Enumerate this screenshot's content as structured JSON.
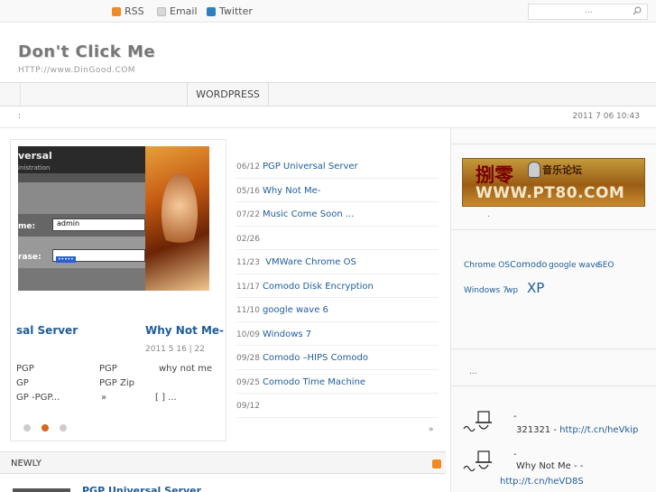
{
  "topbar": {
    "rss_label": "RSS",
    "email_label": "Email",
    "twitter_label": "Twitter",
    "search_placeholder": "...",
    "rss_icon": "rss-icon",
    "email_icon": "mail-icon",
    "twitter_icon": "twitter-icon"
  },
  "header": {
    "site_title": "Don't Click Me",
    "site_url": "HTTP://www.DinGood.COM"
  },
  "nav": {
    "items": [
      "WORDPRESS"
    ]
  },
  "infobar": {
    "left_text": ":",
    "date": "2011 7 06  10:43"
  },
  "slider": {
    "slide1": {
      "img_title": "versal",
      "img_subtitle": "inistration",
      "label_user": "me:",
      "label_pass": "rase:",
      "field_user": "admin",
      "field_pass": "•••••",
      "title": "sal Server"
    },
    "slide2": {
      "title": "Why Not Me-",
      "meta": "2011 5 16  | 22"
    },
    "lines": [
      {
        "a": "PGP",
        "b": "PGP",
        "c": "why not me"
      },
      {
        "a": "GP",
        "b": "PGP Zip",
        "c": ""
      },
      {
        "a": "GP   -PGP...",
        "b": "»",
        "c": "[ ]     ..."
      }
    ],
    "active_dot": 2
  },
  "posts": [
    {
      "date": "06/12",
      "title": "PGP Universal Server"
    },
    {
      "date": "05/16",
      "title": "Why Not Me-"
    },
    {
      "date": "07/22",
      "title": "Music Come Soon ..."
    },
    {
      "date": "02/26",
      "title": ""
    },
    {
      "date": "11/23",
      "title": " VMWare       Chrome OS"
    },
    {
      "date": "11/17",
      "title": "Comodo Disk Encryption"
    },
    {
      "date": "11/10",
      "title": "google wave      6"
    },
    {
      "date": "10/09",
      "title": "Windows 7"
    },
    {
      "date": "09/28",
      "title": "Comodo   –HIPS Comodo"
    },
    {
      "date": "09/25",
      "title": "Comodo Time Machine"
    },
    {
      "date": "09/12",
      "title": ""
    }
  ],
  "posts_more": "»",
  "sidebar": {
    "banner": {
      "cn_left": "捌零",
      "cn_right": "音乐论坛",
      "url": "WWW.PT80.COM"
    },
    "banner_caption": ".",
    "tags": [
      {
        "text": "Chrome OS",
        "size": "9px"
      },
      {
        "text": "Comodo",
        "size": "10px"
      },
      {
        "text": "google wave",
        "size": "9px"
      },
      {
        "text": "SEO",
        "size": "9px"
      },
      {
        "text": "Windows 7",
        "size": "9px"
      },
      {
        "text": "wp",
        "size": "9px"
      },
      {
        "text": "XP",
        "size": "15px"
      }
    ],
    "recent_label": "...",
    "tweets": [
      {
        "dash": "-",
        "text": "321321 - ",
        "link": "http://t.cn/heVkip"
      },
      {
        "dash": "-",
        "text": "Why Not Me -         -",
        "link": "http://t.cn/heVD8S"
      }
    ]
  },
  "newly": {
    "title": "NEWLY",
    "first_post": "PGP Universal Server"
  }
}
